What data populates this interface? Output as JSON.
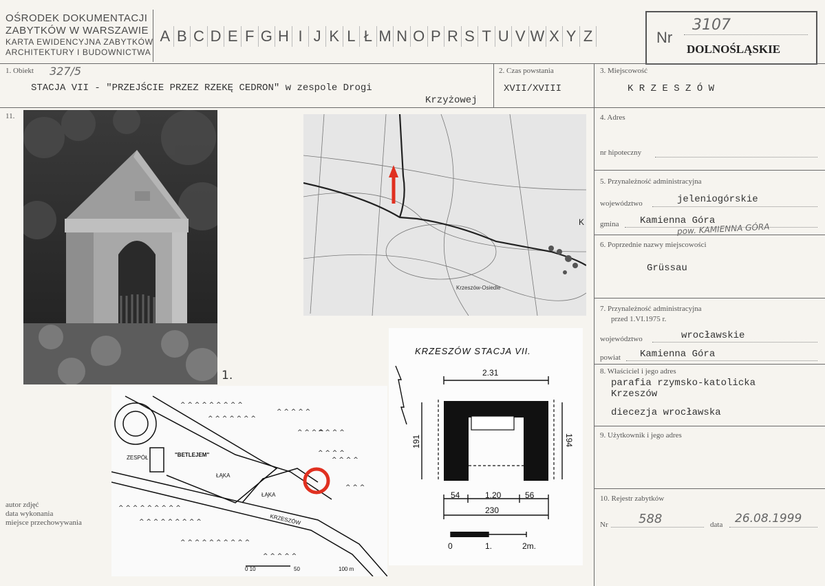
{
  "header": {
    "institution": [
      "OŚRODEK DOKUMENTACJI",
      "ZABYTKÓW W WARSZAWIE",
      "KARTA EWIDENCYJNA ZABYTKÓW",
      "ARCHITEKTURY I BUDOWNICTWA"
    ],
    "letters": [
      "A",
      "B",
      "C",
      "D",
      "E",
      "F",
      "G",
      "H",
      "I",
      "J",
      "K",
      "L",
      "Ł",
      "M",
      "N",
      "O",
      "P",
      "R",
      "S",
      "T",
      "U",
      "V",
      "W",
      "X",
      "Y",
      "Z"
    ],
    "nr_label": "Nr",
    "nr_value": "3107",
    "voivodeship": "DOLNOŚLĄSKIE"
  },
  "fields": {
    "obiekt_label": "1. Obiekt",
    "obiekt_number": "327/5",
    "obiekt_value_line1": "STACJA VII - \"PRZEJŚCIE PRZEZ RZEKĘ CEDRON\" w zespole Drogi",
    "obiekt_value_line2": "Krzyżowej",
    "czas_label": "2. Czas powstania",
    "czas_value": "XVII/XVIII",
    "miejscowosc_label": "3. Miejscowość",
    "miejscowosc_value": "K R Z E S Z Ó W",
    "photo_label": "11.",
    "adres_label": "4. Adres",
    "hipoteczny_label": "nr hipoteczny",
    "przynaleznosc_label": "5. Przynależność administracyjna",
    "wojewodztwo_label": "województwo",
    "wojewodztwo_value": "jeleniogórskie",
    "gmina_label": "gmina",
    "gmina_value": "Kamienna Góra",
    "gmina_hand": "pow. KAMIENNA GÓRA",
    "poprzednie_label": "6. Poprzednie nazwy miejscowości",
    "poprzednie_value": "Grüssau",
    "przed1975_label1": "7. Przynależność administracyjna",
    "przed1975_label2": "przed 1.VI.1975 r.",
    "woj2_label": "województwo",
    "woj2_value": "wrocławskie",
    "powiat_label": "powiat",
    "powiat_value": "Kamienna Góra",
    "wlasciciel_label": "8. Właściciel i jego adres",
    "wlasciciel_line1": "parafia rzymsko-katolicka",
    "wlasciciel_line2": "Krzeszów",
    "wlasciciel_line3": "diecezja wrocławska",
    "uzytkownik_label": "9. Użytkownik i jego adres",
    "rejestr_label": "10. Rejestr zabytków",
    "rejestr_nr_label": "Nr",
    "rejestr_nr_value": "588",
    "rejestr_data_label": "data",
    "rejestr_data_value": "26.08.1999",
    "autor_label": "autor zdjęć",
    "data_wyk_label": "data wykonania",
    "miejsce_label": "miejsce przechowywania"
  },
  "photo_caption": "1.",
  "plan": {
    "title": "KRZESZÓW STACJA VII.",
    "width_top": "2.31",
    "left_dim": "191",
    "right_dim": "194",
    "dims_bottom": [
      "54",
      "1.20",
      "56"
    ],
    "width_bottom": "230",
    "scale": [
      "0",
      "1.",
      "2m."
    ]
  },
  "sitemap": {
    "labels": [
      "ZESPÓŁ",
      "\"BETLEJEM\"",
      "ŁĄKA",
      "ŁĄKA",
      "KRZESZÓW"
    ],
    "scale": [
      "0 10",
      "50",
      "100 m"
    ]
  },
  "topomap": {
    "labels": [
      "Krzeszów-Osiedle",
      "K"
    ]
  }
}
